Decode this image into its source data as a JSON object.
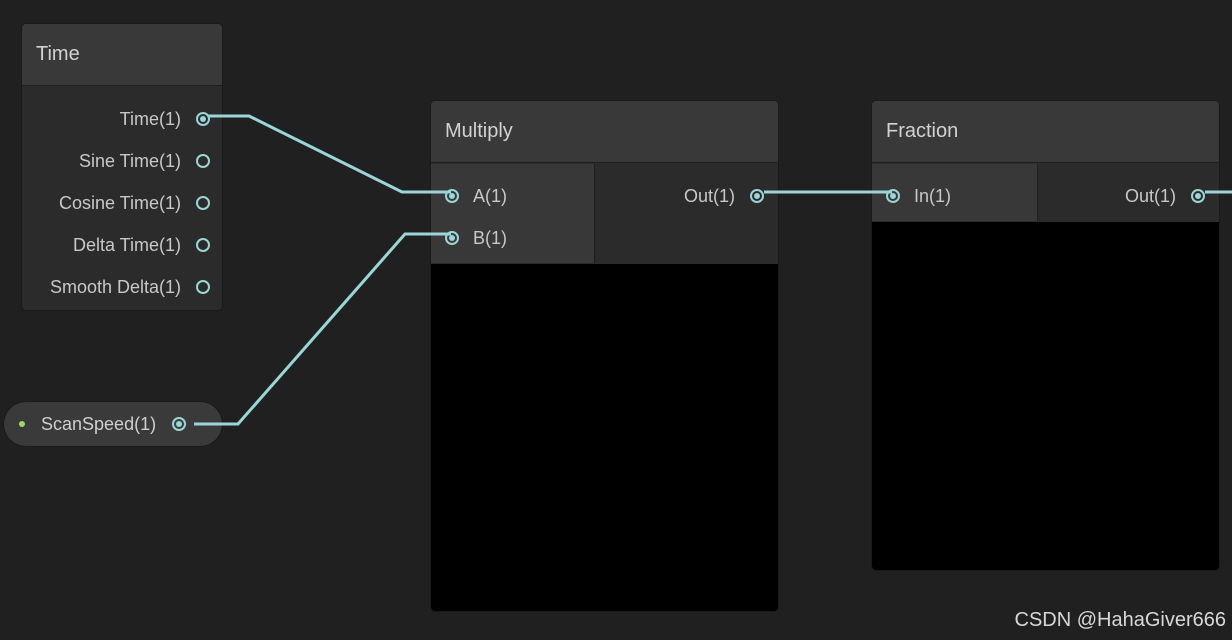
{
  "graph": {
    "time_node": {
      "title": "Time",
      "outputs": [
        {
          "label": "Time(1)",
          "connected": true
        },
        {
          "label": "Sine Time(1)",
          "connected": false
        },
        {
          "label": "Cosine Time(1)",
          "connected": false
        },
        {
          "label": "Delta Time(1)",
          "connected": false
        },
        {
          "label": "Smooth Delta(1)",
          "connected": false
        }
      ]
    },
    "property_node": {
      "label": "ScanSpeed(1)",
      "color": "#9fd66a"
    },
    "multiply_node": {
      "title": "Multiply",
      "inputs": [
        {
          "label": "A(1)"
        },
        {
          "label": "B(1)"
        }
      ],
      "outputs": [
        {
          "label": "Out(1)"
        }
      ]
    },
    "fraction_node": {
      "title": "Fraction",
      "inputs": [
        {
          "label": "In(1)"
        }
      ],
      "outputs": [
        {
          "label": "Out(1)"
        }
      ]
    },
    "wire_color": "#9ad6d8"
  },
  "watermark": "CSDN @HahaGiver666"
}
